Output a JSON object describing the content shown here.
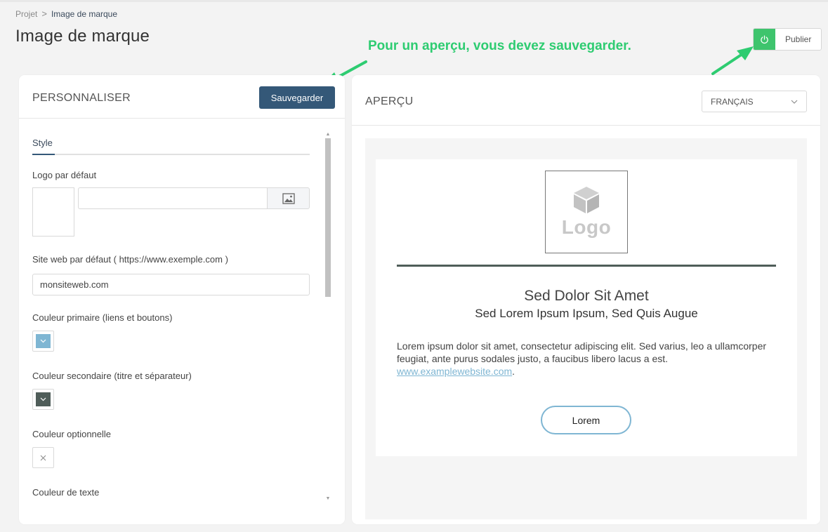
{
  "breadcrumb": {
    "root": "Projet",
    "separator": ">",
    "current": "Image de marque"
  },
  "page": {
    "title": "Image de marque"
  },
  "annotation": {
    "text": "Pour un aperçu, vous devez sauvegarder.",
    "color": "#2ecc71"
  },
  "publish": {
    "label": "Publier",
    "icon": "power-icon",
    "color": "#3ec46d"
  },
  "customize": {
    "title": "PERSONNALISER",
    "save_label": "Sauvegarder",
    "tab_style": "Style",
    "logo_label": "Logo par défaut",
    "site_label": "Site web par défaut ( https://www.exemple.com )",
    "site_value": "monsiteweb.com",
    "primary_label": "Couleur primaire (liens et boutons)",
    "primary_color": "#7fb6d3",
    "secondary_label": "Couleur secondaire (titre et séparateur)",
    "secondary_color": "#4f5d59",
    "optional_label": "Couleur optionnelle",
    "text_label": "Couleur de texte"
  },
  "preview": {
    "title": "APERÇU",
    "language": "FRANÇAIS",
    "logo_text": "Logo",
    "heading": "Sed Dolor Sit Amet",
    "subheading": "Sed Lorem Ipsum Ipsum, Sed Quis Augue",
    "body": "Lorem ipsum dolor sit amet, consectetur adipiscing elit. Sed varius, leo a ullamcorper feugiat, ante purus sodales justo, a faucibus libero lacus a est.",
    "link": "www.examplewebsite.com",
    "link_suffix": ".",
    "button_label": "Lorem"
  }
}
